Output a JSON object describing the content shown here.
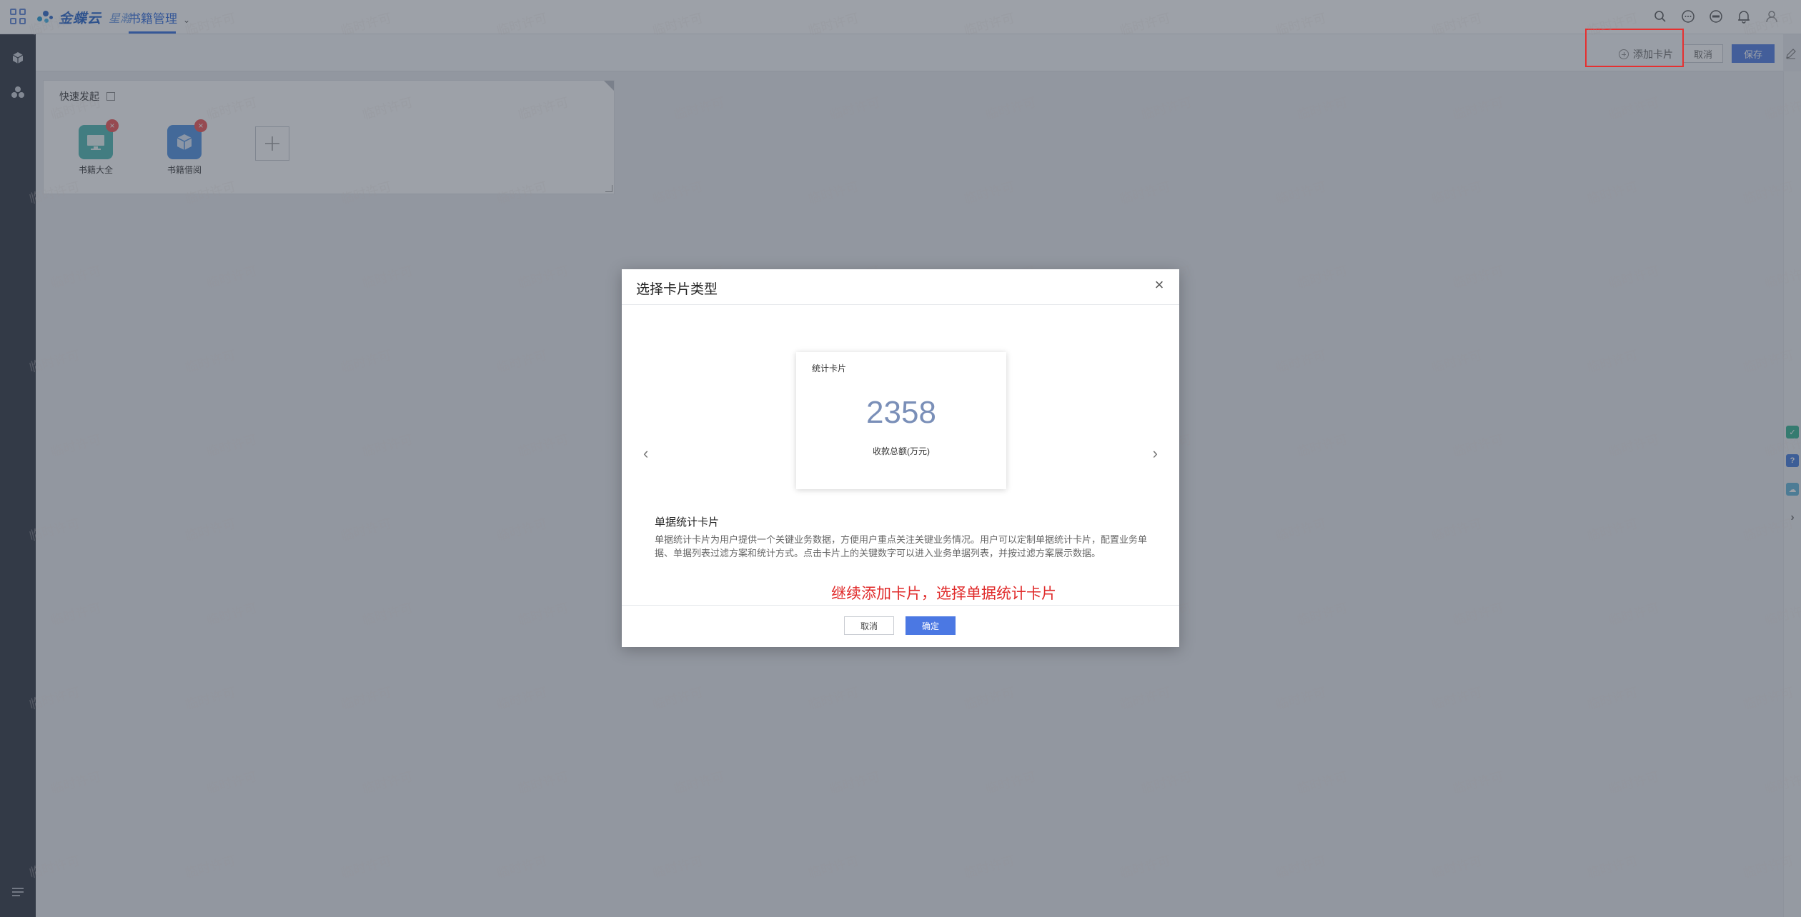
{
  "app": {
    "logo_text": "金蝶云",
    "logo_sub": "星瀚",
    "nav_title": "书籍管理"
  },
  "toolbar": {
    "add_card_label": "添加卡片",
    "cancel_label": "取消",
    "save_label": "保存"
  },
  "quick_start": {
    "title": "快速发起",
    "apps": [
      {
        "label": "书籍大全",
        "color": "#48b7b0",
        "icon": "monitor-icon"
      },
      {
        "label": "书籍借阅",
        "color": "#4a8fe0",
        "icon": "cube-icon"
      }
    ]
  },
  "modal": {
    "title": "选择卡片类型",
    "preview": {
      "title": "统计卡片",
      "number": "2358",
      "caption": "收款总额(万元)"
    },
    "desc_title": "单据统计卡片",
    "desc_body": "单据统计卡片为用户提供一个关键业务数据，方便用户重点关注关键业务情况。用户可以定制单据统计卡片，配置业务单据、单据列表过滤方案和统计方式。点击卡片上的关键数字可以进入业务单据列表，并按过滤方案展示数据。",
    "annotation": "继续添加卡片，选择单据统计卡片",
    "cancel_label": "取消",
    "ok_label": "确定"
  },
  "watermark_text": "临时许可",
  "colors": {
    "primary": "#4b78e3",
    "sidebar": "#2b313d",
    "highlight_box": "#e63030",
    "annotation": "#e02b2b"
  }
}
